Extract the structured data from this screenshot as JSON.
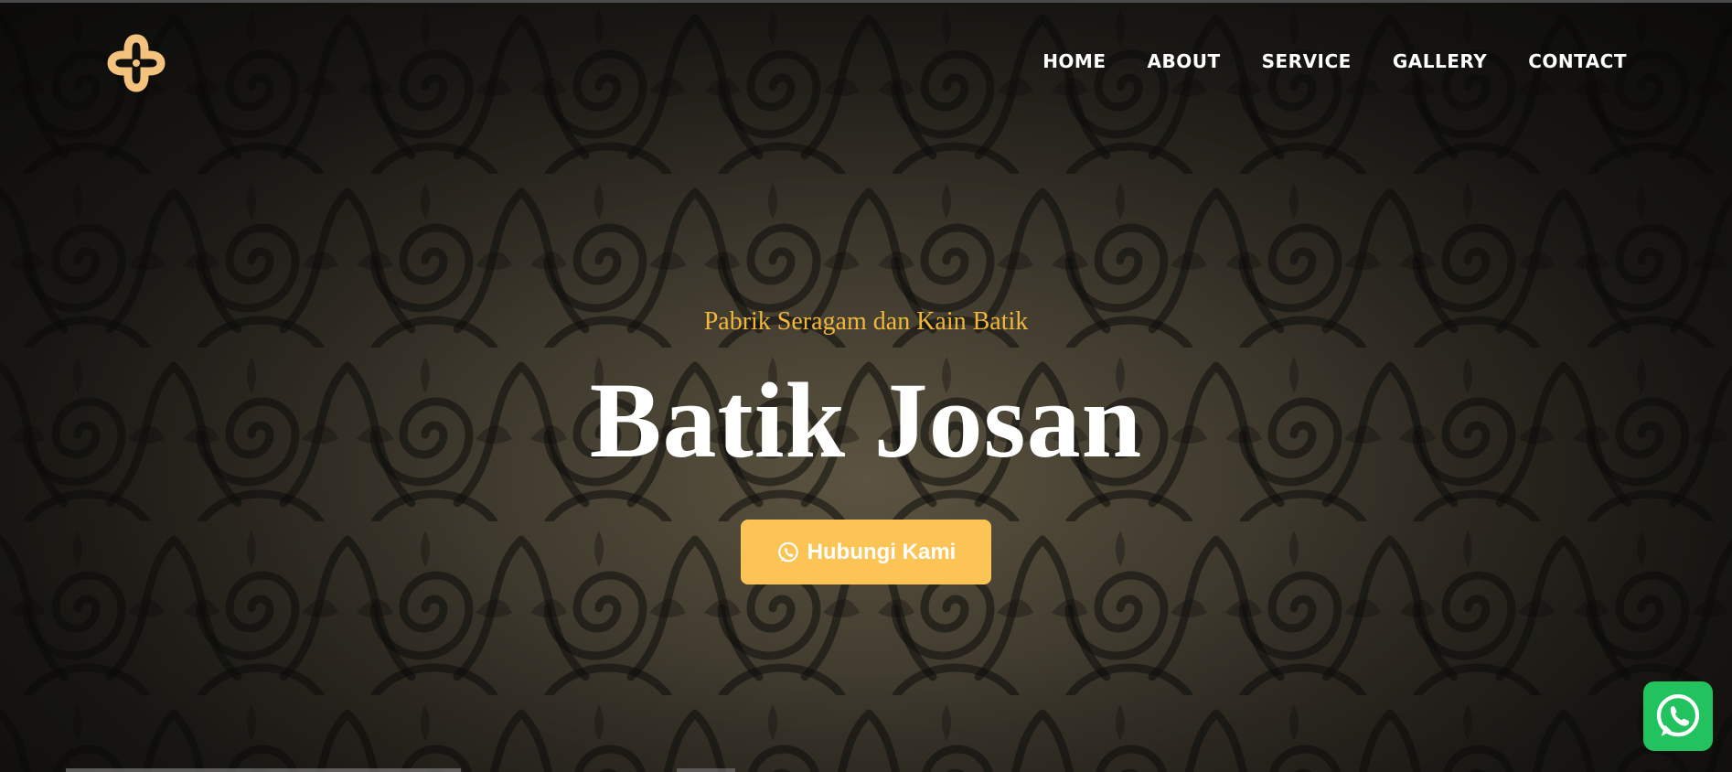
{
  "header": {
    "logo_icon": "cross-logo-icon",
    "nav": [
      {
        "label": "HOME"
      },
      {
        "label": "ABOUT"
      },
      {
        "label": "SERVICE"
      },
      {
        "label": "GALLERY"
      },
      {
        "label": "CONTACT"
      }
    ]
  },
  "hero": {
    "subtitle": "Pabrik Seragam dan Kain Batik",
    "title": "Batik Josan",
    "cta_label": "Hubungi Kami",
    "cta_icon": "whatsapp-icon"
  },
  "floating": {
    "icon": "whatsapp-icon"
  },
  "colors": {
    "accent": "#f1b73a",
    "button": "#fbc455",
    "whatsapp": "#22c35e",
    "logo": "#f3c27c"
  }
}
